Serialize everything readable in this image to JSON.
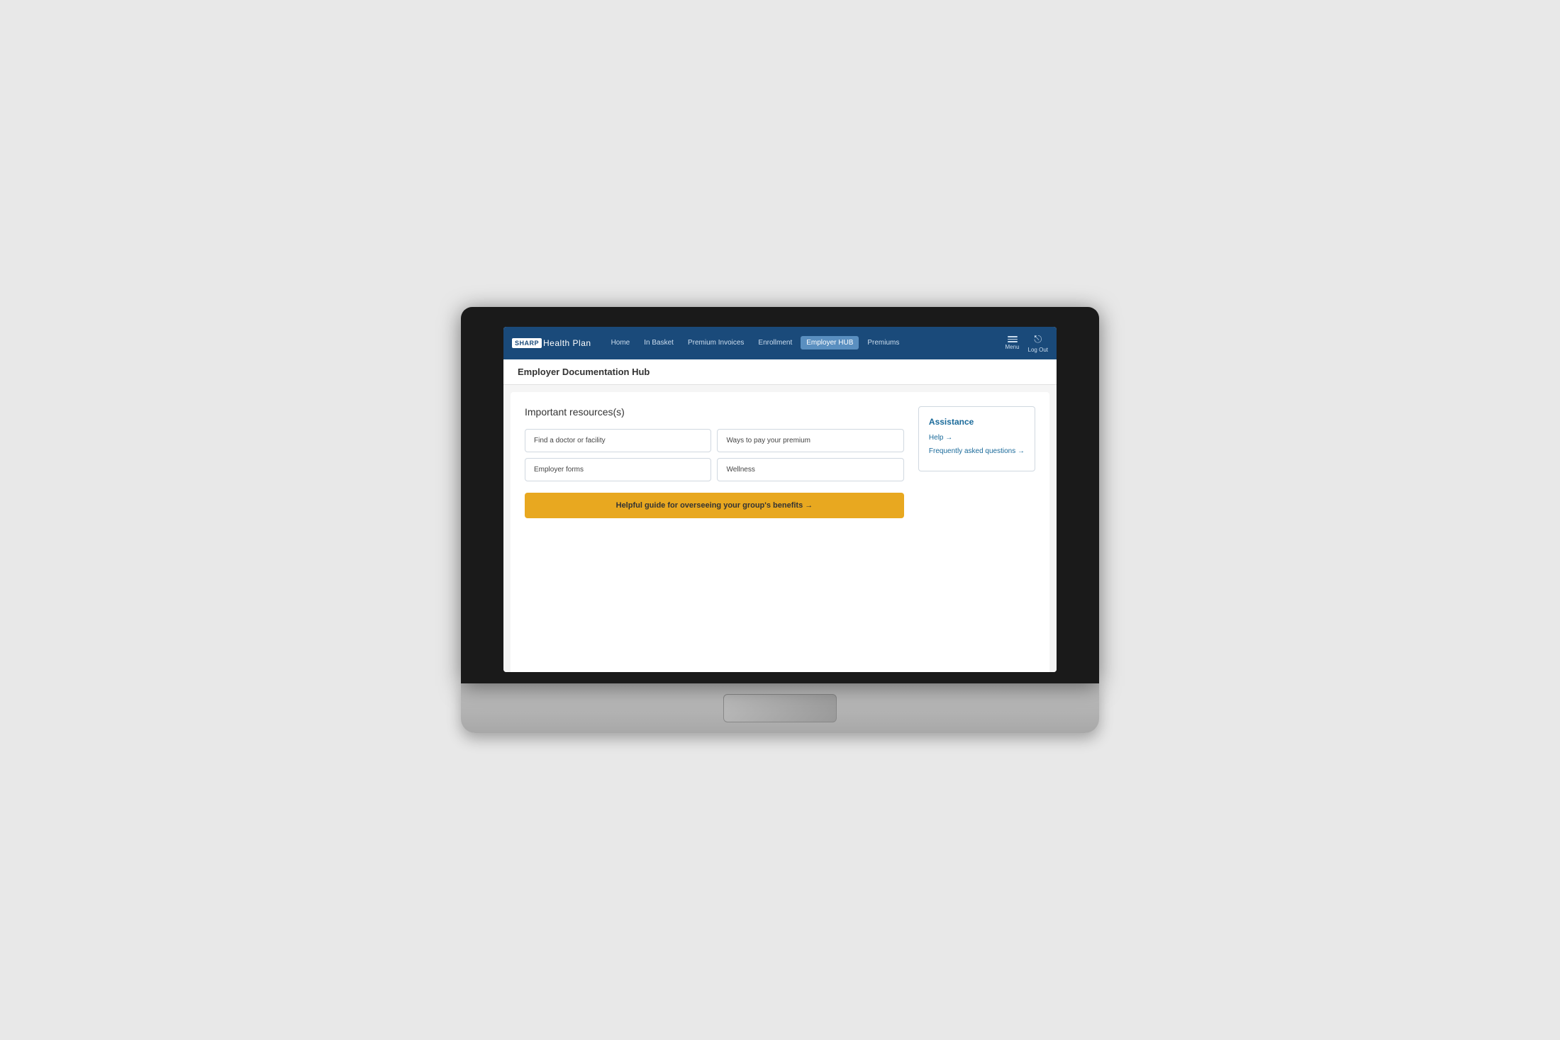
{
  "laptop": {
    "screen": {
      "nav": {
        "logo": {
          "sharp": "SHARP",
          "health_plan": "Health Plan"
        },
        "links": [
          {
            "label": "Home",
            "active": false
          },
          {
            "label": "In Basket",
            "active": false
          },
          {
            "label": "Premium Invoices",
            "active": false
          },
          {
            "label": "Enrollment",
            "active": false
          },
          {
            "label": "Employer HUB",
            "active": true
          },
          {
            "label": "Premiums",
            "active": false
          }
        ],
        "menu_label": "Menu",
        "logout_label": "Log Out"
      },
      "page": {
        "title": "Employer Documentation Hub",
        "resources_section_title": "Important resources(s)",
        "resources": [
          {
            "label": "Find a doctor or facility"
          },
          {
            "label": "Ways to pay your premium"
          },
          {
            "label": "Employer forms"
          },
          {
            "label": "Wellness"
          }
        ],
        "guide_btn": "Helpful guide for overseeing your group's benefits →",
        "assistance": {
          "title": "Assistance",
          "help": "Help →",
          "faq": "Frequently asked questions →"
        }
      }
    }
  }
}
